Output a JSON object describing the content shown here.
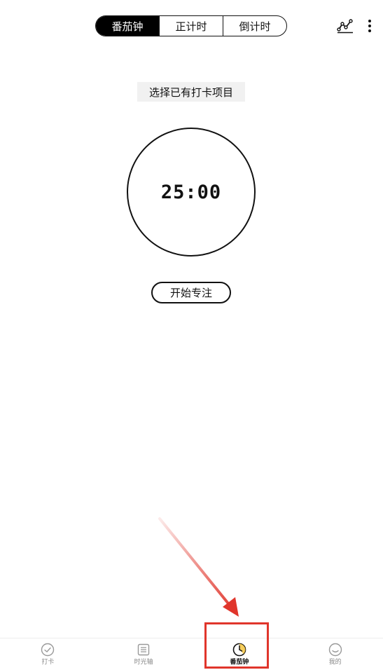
{
  "header": {
    "tabs": [
      {
        "label": "番茄钟",
        "active": true
      },
      {
        "label": "正计时",
        "active": false
      },
      {
        "label": "倒计时",
        "active": false
      }
    ],
    "stats_icon": "line-chart-icon",
    "more_icon": "more-vertical-icon"
  },
  "main": {
    "select_project_label": "选择已有打卡项目",
    "timer": "25:00",
    "start_label": "开始专注"
  },
  "bottom_nav": {
    "items": [
      {
        "label": "打卡",
        "icon": "check-circle-icon",
        "active": false
      },
      {
        "label": "时光轴",
        "icon": "list-icon",
        "active": false
      },
      {
        "label": "番茄钟",
        "icon": "clock-icon",
        "active": true
      },
      {
        "label": "我的",
        "icon": "smiley-icon",
        "active": false
      }
    ]
  },
  "annotation": {
    "color": "#e0352b"
  }
}
